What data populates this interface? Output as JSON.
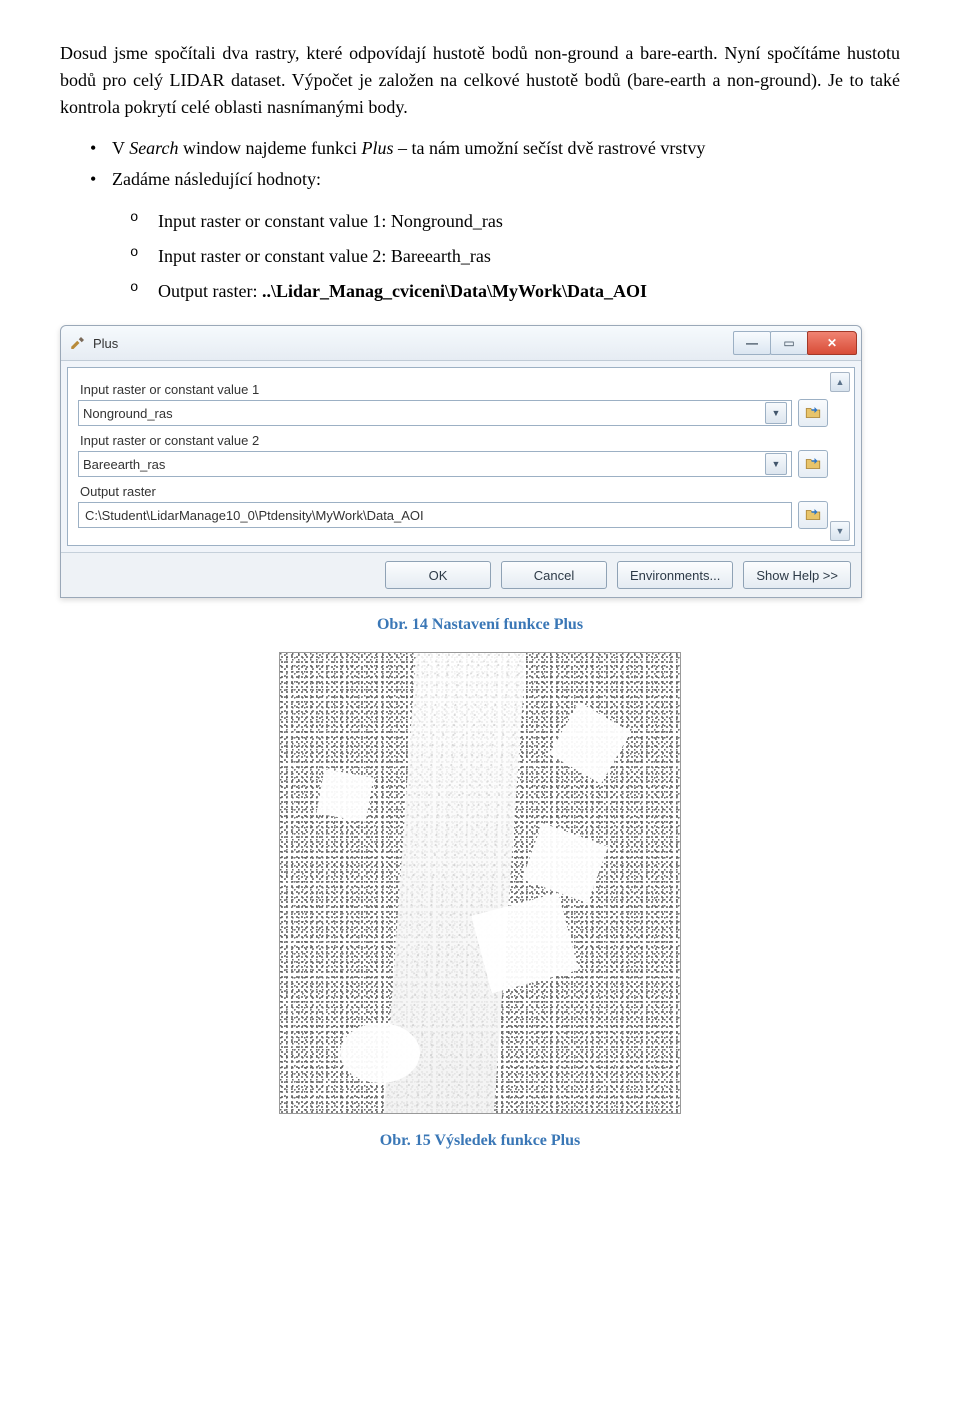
{
  "para1": "Dosud jsme spočítali dva rastry, které odpovídají hustotě bodů non-ground a bare-earth. Nyní spočítáme hustotu bodů pro celý LIDAR dataset. Výpočet je založen na celkové hustotě bodů (bare-earth a non-ground). Je to také kontrola pokrytí celé oblasti nasnímanými body.",
  "bullets": {
    "b1_pre": "V ",
    "b1_it1": "Search",
    "b1_mid": " window najdeme funkci ",
    "b1_it2": "Plus",
    "b1_post": " – ta nám umožní sečíst dvě rastrové vrstvy",
    "b2": "Zadáme následující hodnoty:"
  },
  "sublist": {
    "s1": "Input raster or constant value 1: Nonground_ras",
    "s2": "Input raster or constant value 2: Bareearth_ras",
    "s3_pre": "Output raster: ",
    "s3_bold": "..\\Lidar_Manag_cviceni\\Data\\MyWork\\Data_AOI"
  },
  "dialog": {
    "title": "Plus",
    "label1": "Input raster or constant value 1",
    "value1": "Nonground_ras",
    "label2": "Input raster or constant value 2",
    "value2": "Bareearth_ras",
    "label3": "Output raster",
    "value3": "C:\\Student\\LidarManage10_0\\Ptdensity\\MyWork\\Data_AOI",
    "buttons": {
      "ok": "OK",
      "cancel": "Cancel",
      "env": "Environments...",
      "help": "Show Help >>"
    }
  },
  "caption1": "Obr. 14 Nastavení funkce Plus",
  "caption2": "Obr. 15 Výsledek funkce Plus"
}
